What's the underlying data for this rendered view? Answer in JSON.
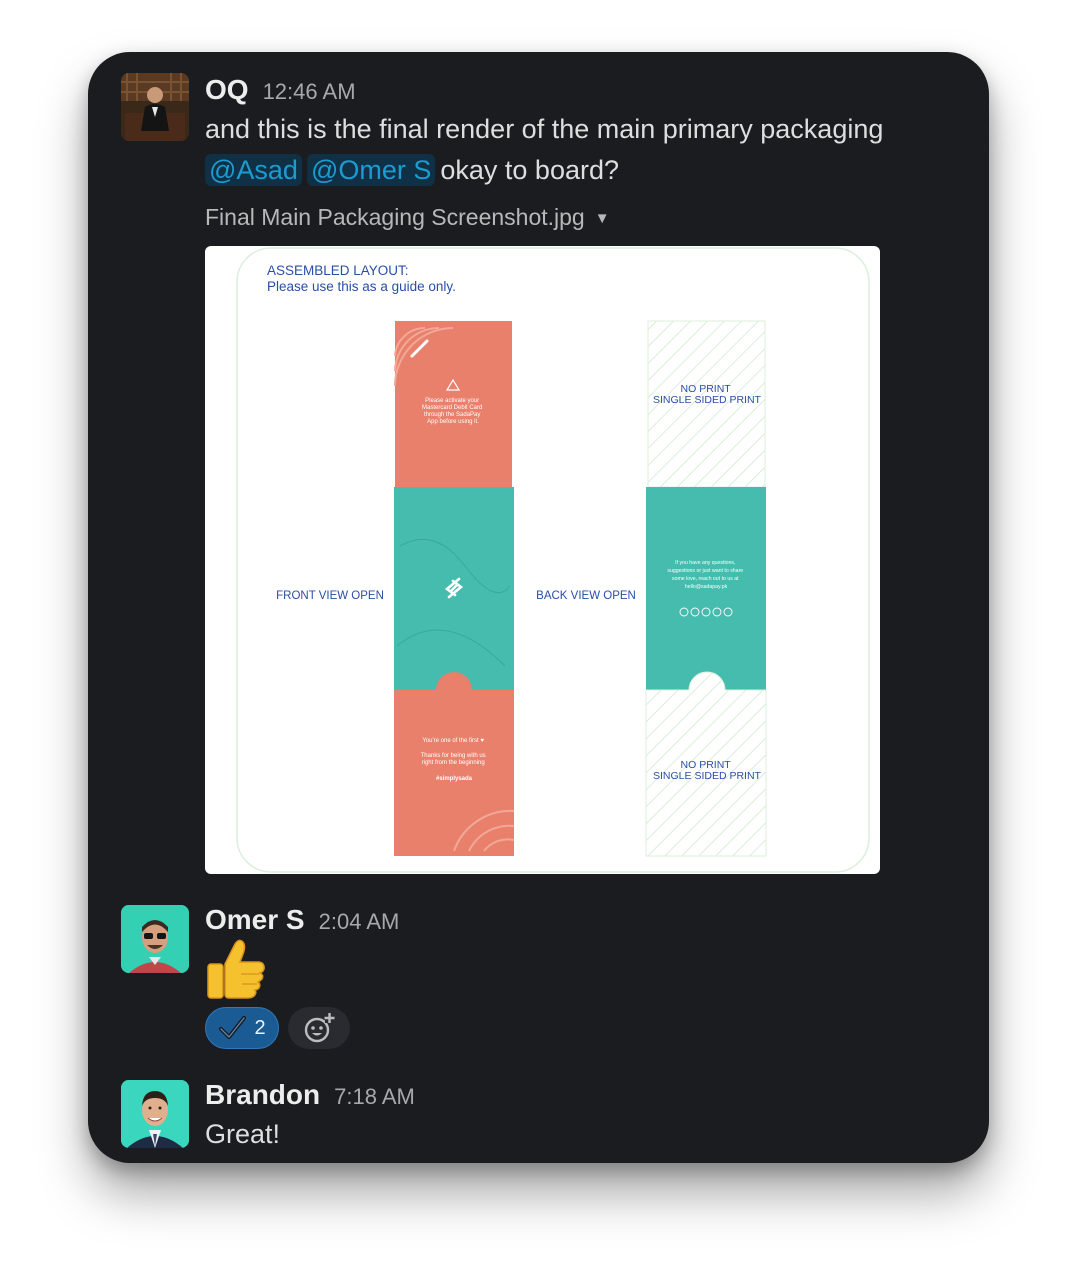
{
  "messages": [
    {
      "sender": "OQ",
      "time": "12:46 AM",
      "text_line1": "and this is the final render of the main primary packaging",
      "mentions": [
        "@Asad",
        "@Omer S"
      ],
      "text_line2": "okay to board?",
      "attachment": {
        "filename": "Final Main Packaging Screenshot.jpg",
        "image": {
          "heading_line1": "ASSEMBLED LAYOUT:",
          "heading_line2": "Please use this as a guide only.",
          "front_label": "FRONT VIEW OPEN",
          "back_label": "BACK VIEW OPEN",
          "front_top_text": [
            "Please activate your",
            "Mastercard Debit Card",
            "through the SadaPay",
            "App before using it."
          ],
          "front_bottom_text": [
            "You're one of the first ♥",
            "Thanks for being with us",
            "right from the beginning",
            "#simplysada"
          ],
          "back_top_text": [
            "NO PRINT",
            "SINGLE SIDED PRINT"
          ],
          "back_bottom_text": [
            "NO PRINT",
            "SINGLE SIDED PRINT"
          ],
          "back_middle_text": [
            "If you have any questions,",
            "suggestions or just want to share",
            "some love, reach out to us at",
            "hello@sadapay.pk"
          ]
        }
      }
    },
    {
      "sender": "Omer S",
      "time": "2:04 AM",
      "emoji": "👍",
      "reaction": {
        "emoji_name": "checkmark",
        "count": "2"
      }
    },
    {
      "sender": "Brandon",
      "time": "7:18 AM",
      "text": "Great!"
    }
  ],
  "colors": {
    "background": "#1b1c20",
    "mention": "#1d9bd1",
    "reaction": "#1b5b94",
    "coral": "#e8806c",
    "teal": "#45bcad",
    "guide_text": "#2a4ea6"
  }
}
